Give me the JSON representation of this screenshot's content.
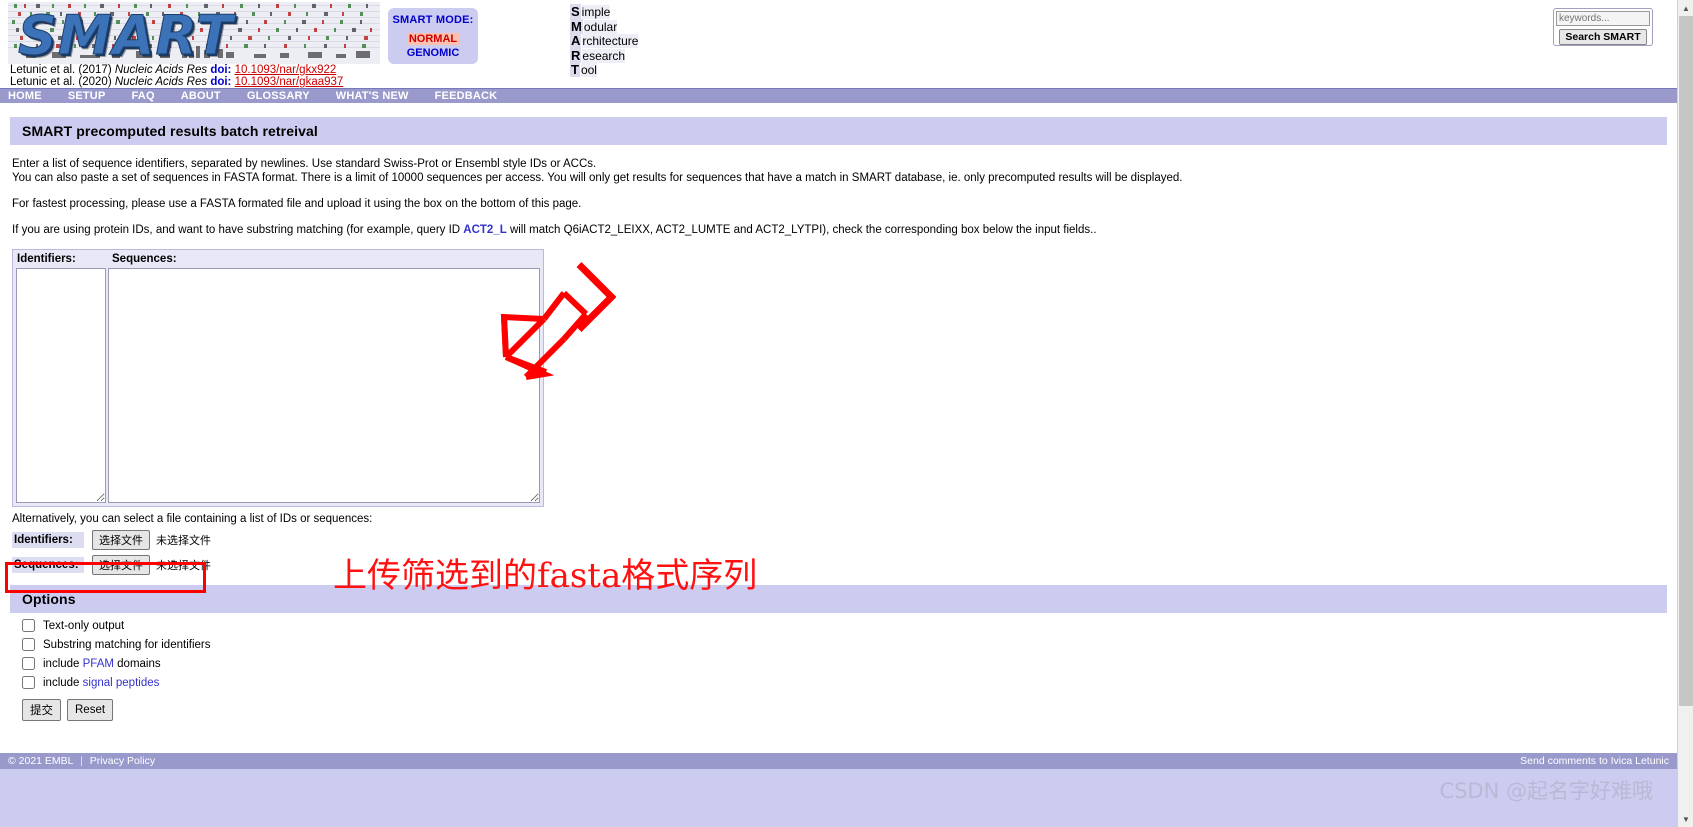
{
  "header": {
    "logo_word": "SMART",
    "logo_alt": "SMART sequence alignment logo",
    "citations": [
      {
        "authors": "Letunic et al. (2017)",
        "journal": "Nucleic Acids Res",
        "doi_label": "doi:",
        "doi": "10.1093/nar/gkx922"
      },
      {
        "authors": "Letunic et al. (2020)",
        "journal": "Nucleic Acids Res",
        "doi_label": "doi:",
        "doi": "10.1093/nar/gkaa937"
      }
    ],
    "mode_box": {
      "title": "SMART MODE:",
      "normal": "NORMAL",
      "genomic": "GENOMIC",
      "normal_highlight_color": "#ffc0b0",
      "accent_color": "#0000cc"
    },
    "acronym": [
      {
        "letter": "S",
        "rest": "imple"
      },
      {
        "letter": "M",
        "rest": "odular"
      },
      {
        "letter": "A",
        "rest": "rchitecture"
      },
      {
        "letter": "R",
        "rest": "esearch"
      },
      {
        "letter": "T",
        "rest": "ool"
      }
    ],
    "search": {
      "placeholder": "keywords...",
      "value": "",
      "button_label": "Search SMART"
    }
  },
  "nav": {
    "items": [
      {
        "label": "HOME"
      },
      {
        "label": "SETUP"
      },
      {
        "label": "FAQ"
      },
      {
        "label": "ABOUT"
      },
      {
        "label": "GLOSSARY"
      },
      {
        "label": "WHAT'S NEW"
      },
      {
        "label": "FEEDBACK"
      }
    ],
    "bg_color": "#9999cc"
  },
  "page": {
    "title": "SMART precomputed results batch retreival",
    "intro": {
      "p1_line1": "Enter a list of sequence identifiers, separated by newlines. Use standard Swiss-Prot or Ensembl style IDs or ACCs.",
      "p1_line2": "You can also paste a set of sequences in FASTA format. There is a limit of 10000 sequences per access. You will only get results for sequences that have a match in SMART database, ie. only precomputed results will be displayed.",
      "p2": "For fastest processing, please use a FASTA formated file and upload it using the box on the bottom of this page.",
      "p3_before": "If you are using protein IDs, and want to have substring matching (for example, query ID ",
      "p3_link": "ACT2_L",
      "p3_after": " will match Q6iACT2_LEIXX, ACT2_LUMTE and ACT2_LYTPI), check the corresponding box below the input fields.."
    },
    "form": {
      "identifiers_header": "Identifiers:",
      "sequences_header": "Sequences:",
      "identifiers_value": "",
      "sequences_value": "",
      "alt_text": "Alternatively, you can select a file containing a list of IDs or sequences:",
      "upload_identifiers_label": "Identifiers:",
      "upload_sequences_label": "Sequences:",
      "choose_file_button": "选择文件",
      "no_file_chosen": "未选择文件"
    },
    "options": {
      "title": "Options",
      "items": [
        {
          "label": "Text-only output",
          "checked": false
        },
        {
          "label": "Substring matching for identifiers",
          "checked": false
        },
        {
          "label_before": "include ",
          "link": "PFAM",
          "label_after": " domains",
          "checked": false
        },
        {
          "label_before": "include ",
          "link": "signal peptides",
          "label_after": "",
          "checked": false
        }
      ],
      "submit_label": "提交",
      "reset_label": "Reset"
    },
    "annotations": {
      "chinese_note": "上传筛选到的fasta格式序列",
      "note_color": "#ff1111",
      "highlight_box_color": "#ff0000",
      "arrow_color": "#ff0000"
    }
  },
  "footer": {
    "copyright": "© 2021 EMBL",
    "separator": "|",
    "privacy": "Privacy Policy",
    "comments_prefix": "Send comments to ",
    "comments_link": "Ivica Letunic",
    "bg_color": "#9999cc"
  },
  "watermark": {
    "text": "CSDN @起名字好难哦"
  }
}
